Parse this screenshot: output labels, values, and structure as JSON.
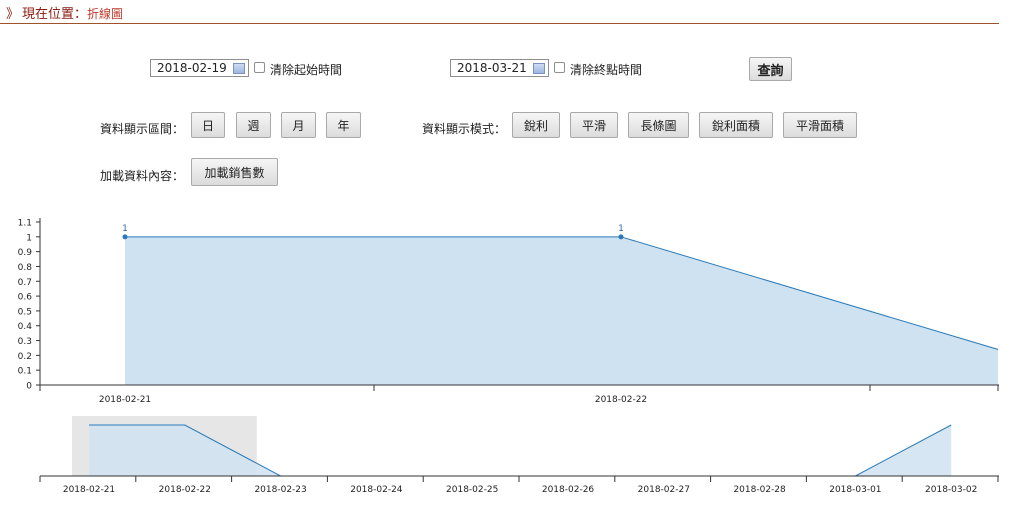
{
  "breadcrumb": {
    "arrow": "》",
    "prefix": "現在位置：",
    "current": "折線圖"
  },
  "filters": {
    "start_date": "2018-02-19",
    "clear_start_label": "清除起始時間",
    "end_date": "2018-03-21",
    "clear_end_label": "清除終點時間",
    "query_label": "查詢"
  },
  "interval": {
    "label": "資料顯示區間：",
    "buttons": [
      "日",
      "週",
      "月",
      "年"
    ]
  },
  "mode": {
    "label": "資料顯示模式：",
    "buttons": [
      "銳利",
      "平滑",
      "長條圖",
      "銳利面積",
      "平滑面積"
    ]
  },
  "load": {
    "label": "加載資料內容：",
    "button": "加載銷售數"
  },
  "colors": {
    "line": "#2b7bb9",
    "area": "#cfe2f1",
    "brush": "#e6e6e6"
  },
  "chart_data": [
    {
      "type": "area",
      "x": [
        "2018-02-21",
        "2018-02-22",
        "2018-02-23"
      ],
      "values": [
        1,
        1,
        0
      ],
      "point_labels": [
        "1",
        "1",
        ""
      ],
      "ylim": [
        0,
        1.1
      ],
      "yticks": [
        "0",
        "0.1",
        "0.2",
        "0.3",
        "0.4",
        "0.5",
        "0.6",
        "0.7",
        "0.8",
        "0.9",
        "1",
        "1.1"
      ],
      "xtick_labels": [
        "2018-02-21",
        "2018-02-22"
      ],
      "grid": false
    },
    {
      "type": "area",
      "x": [
        "2018-02-21",
        "2018-02-22",
        "2018-02-23",
        "2018-02-24",
        "2018-02-25",
        "2018-02-26",
        "2018-02-27",
        "2018-02-28",
        "2018-03-01",
        "2018-03-02"
      ],
      "values": [
        1,
        1,
        0,
        0,
        0,
        0,
        0,
        0,
        0,
        1
      ],
      "xtick_labels": [
        "2018-02-21",
        "2018-02-22",
        "2018-02-23",
        "2018-02-24",
        "2018-02-25",
        "2018-02-26",
        "2018-02-27",
        "2018-02-28",
        "2018-03-01",
        "2018-03-02"
      ],
      "brush_range": [
        "2018-02-21",
        "2018-02-22"
      ],
      "grid": false
    }
  ]
}
